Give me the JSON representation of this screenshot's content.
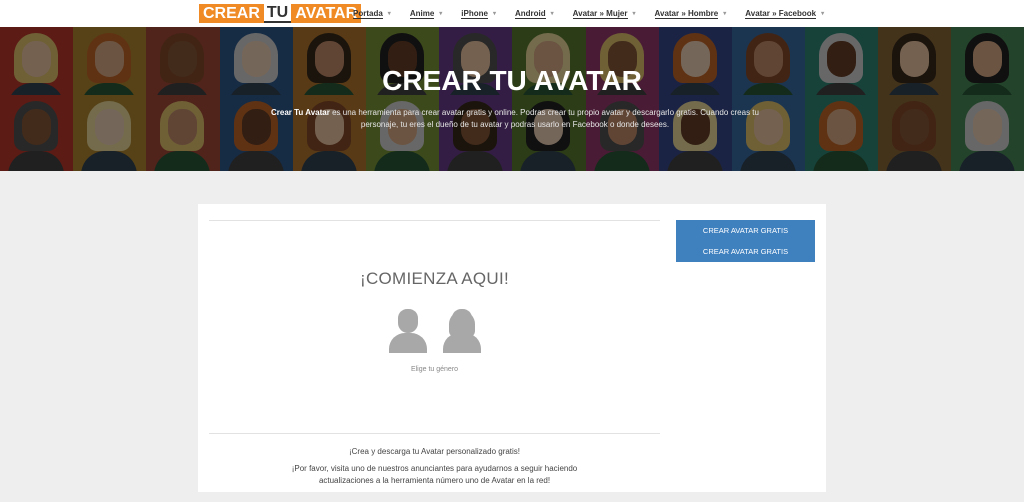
{
  "header": {
    "logo": {
      "part1": "CREAR",
      "part2": "TU",
      "part3": "AVATAR"
    },
    "nav": [
      {
        "label": "Portada"
      },
      {
        "label": "Anime"
      },
      {
        "label": "iPhone"
      },
      {
        "label": "Android"
      },
      {
        "label": "Avatar » Mujer"
      },
      {
        "label": "Avatar » Hombre"
      },
      {
        "label": "Avatar » Facebook"
      }
    ]
  },
  "hero": {
    "title": "CREAR TU AVATAR",
    "brand": "Crear Tu Avatar",
    "description": " es una herramienta para crear avatar gratis y online. Podras crear tu propio avatar y descargarlo gratis. Cuando creas tu personaje, tu eres el dueño de tu avatar y podras usarlo en Facebook o donde desees."
  },
  "main": {
    "start_title": "¡COMIENZA AQUI!",
    "choose_gender": "Elige tu género",
    "promo_line1": "¡Crea y descarga tu Avatar personalizado gratis!",
    "promo_line2": "¡Por favor, visita uno de nuestros anunciantes para ayudarnos a seguir haciendo actualizaciones a la herramienta número uno de Avatar en la red!"
  },
  "sidebar": {
    "links": [
      {
        "label": "CREAR AVATAR GRATIS"
      },
      {
        "label": "CREAR AVATAR GRATIS"
      }
    ]
  },
  "colors": {
    "logo_orange": "#f08a24",
    "sidebar_blue": "#3f80bf",
    "page_bg": "#eeeeee"
  }
}
